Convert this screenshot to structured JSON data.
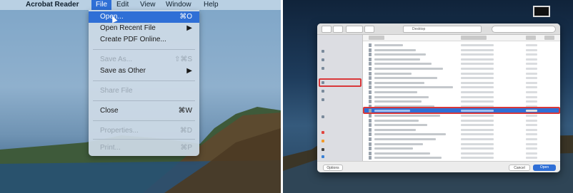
{
  "menubar": {
    "apple_icon": "apple-icon",
    "app_name": "Acrobat Reader",
    "items": [
      "File",
      "Edit",
      "View",
      "Window",
      "Help"
    ]
  },
  "file_menu": {
    "items": [
      {
        "label": "Open...",
        "shortcut": "⌘O",
        "enabled": true,
        "selected": true
      },
      {
        "label": "Open Recent File",
        "shortcut": "▶",
        "enabled": true
      },
      {
        "label": "Create PDF Online...",
        "shortcut": "",
        "enabled": true
      },
      {
        "label": "Save As...",
        "shortcut": "⇧⌘S",
        "enabled": false
      },
      {
        "label": "Save as Other",
        "shortcut": "▶",
        "enabled": true
      },
      {
        "label": "Share File",
        "shortcut": "",
        "enabled": false
      },
      {
        "label": "Close",
        "shortcut": "⌘W",
        "enabled": true
      },
      {
        "label": "Properties...",
        "shortcut": "⌘D",
        "enabled": false
      },
      {
        "label": "Print...",
        "shortcut": "⌘P",
        "enabled": false
      }
    ]
  },
  "dialog": {
    "location": "Desktop",
    "buttons": {
      "options": "Options",
      "cancel": "Cancel",
      "open": "Open"
    }
  },
  "colors": {
    "highlight": "#2f6fd6",
    "annotation": "#d9383a"
  }
}
